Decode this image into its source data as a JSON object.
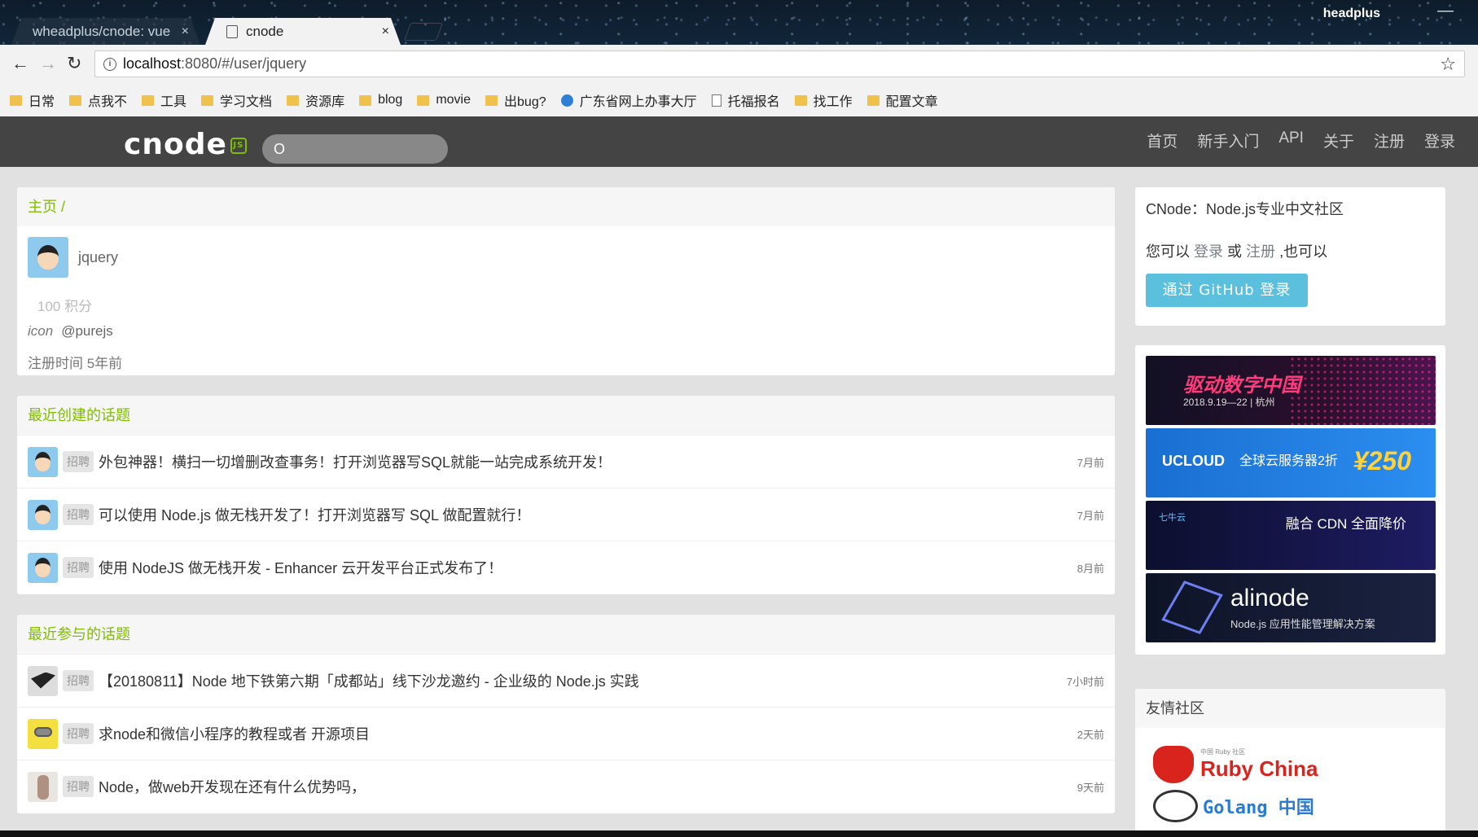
{
  "browser": {
    "tabs": [
      {
        "title": "wheadplus/cnode: vue",
        "close": "×"
      },
      {
        "title": "cnode",
        "close": "×"
      }
    ],
    "profile": "headplus",
    "minimize": "—",
    "url_host": "localhost",
    "url_path": ":8080/#/user/jquery",
    "bookmarks": [
      {
        "label": "日常",
        "icon": "folder"
      },
      {
        "label": "点我不",
        "icon": "folder"
      },
      {
        "label": "工具",
        "icon": "folder"
      },
      {
        "label": "学习文档",
        "icon": "folder"
      },
      {
        "label": "资源库",
        "icon": "folder"
      },
      {
        "label": "blog",
        "icon": "folder"
      },
      {
        "label": "movie",
        "icon": "folder"
      },
      {
        "label": "出bug?",
        "icon": "folder"
      },
      {
        "label": "广东省网上办事大厅",
        "icon": "globe"
      },
      {
        "label": "托福报名",
        "icon": "doc"
      },
      {
        "label": "找工作",
        "icon": "folder"
      },
      {
        "label": "配置文章",
        "icon": "folder"
      }
    ]
  },
  "site": {
    "logo": "cnode",
    "logo_badge": "JS",
    "search_value": "O",
    "nav": [
      "首页",
      "新手入门",
      "API",
      "关于",
      "注册",
      "登录"
    ]
  },
  "profile": {
    "breadcrumb": "主页 /",
    "username": "jquery",
    "score": "100 积分",
    "github_icon": "icon",
    "github": "@purejs",
    "registered": "注册时间 5年前"
  },
  "recent_created": {
    "title": "最近创建的话题",
    "topics": [
      {
        "tag": "招聘",
        "title": "外包神器！横扫一切增删改查事务！打开浏览器写SQL就能一站完成系统开发！",
        "time": "7月前"
      },
      {
        "tag": "招聘",
        "title": "可以使用 Node.js 做无栈开发了！打开浏览器写 SQL 做配置就行！",
        "time": "7月前"
      },
      {
        "tag": "招聘",
        "title": "使用 NodeJS 做无栈开发 - Enhancer 云开发平台正式发布了！",
        "time": "8月前"
      }
    ]
  },
  "recent_replied": {
    "title": "最近参与的话题",
    "topics": [
      {
        "tag": "招聘",
        "title": "【20180811】Node 地下铁第六期「成都站」线下沙龙邀约 - 企业级的 Node.js 实践",
        "time": "7小时前"
      },
      {
        "tag": "招聘",
        "title": "求node和微信小程序的教程或者 开源项目",
        "time": "2天前"
      },
      {
        "tag": "招聘",
        "title": "Node，做web开发现在还有什么优势吗，",
        "time": "9天前"
      }
    ]
  },
  "sidebar": {
    "intro": "CNode：Node.js专业中文社区",
    "can_prefix": "您可以",
    "login_link": "登录",
    "or": "或",
    "register_link": "注册",
    "can_suffix": ",也可以",
    "github_button": "通过 GitHub 登录",
    "ads": [
      {
        "title": "驱动数字中国",
        "sub": "2018.9.19—22 | 杭州"
      },
      {
        "brand": "UCLOUD",
        "title": "全球云服务器2折",
        "price": "¥250"
      },
      {
        "brand": "七牛云",
        "title": "融合 CDN 全面降价"
      },
      {
        "name": "alinode",
        "sub": "Node.js 应用性能管理解决方案"
      }
    ],
    "friends_title": "友情社区",
    "friends": {
      "ruby_small": "中国 Ruby 社区",
      "ruby": "Ruby China",
      "golang": "Golang 中国"
    }
  }
}
